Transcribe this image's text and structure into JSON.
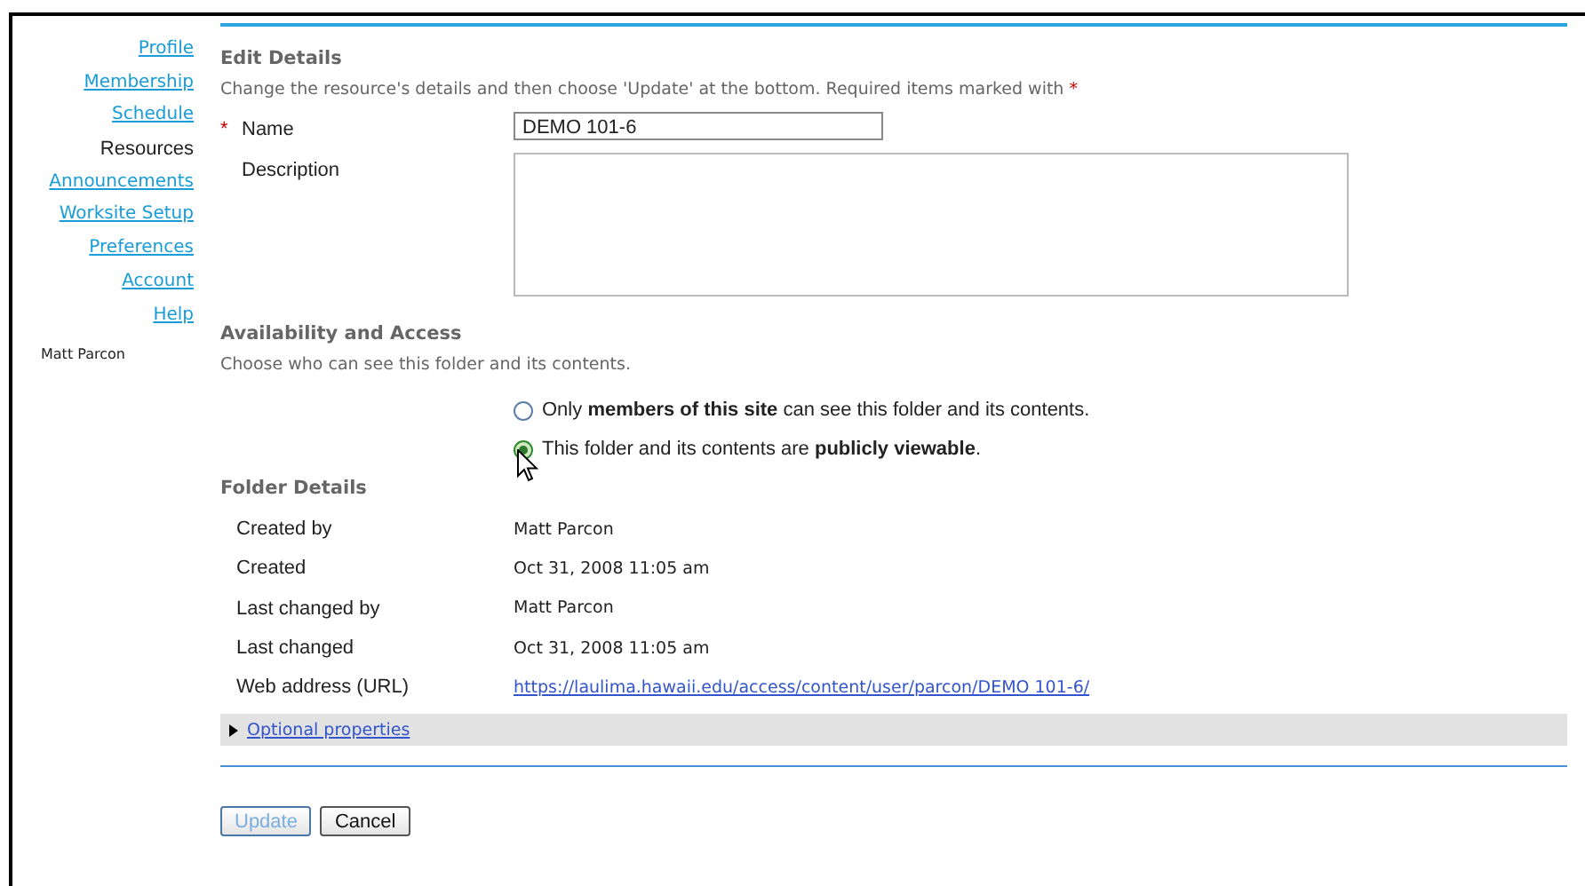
{
  "sidebar": {
    "items": [
      {
        "label": "Profile",
        "selected": false
      },
      {
        "label": "Membership",
        "selected": false
      },
      {
        "label": "Schedule",
        "selected": false
      },
      {
        "label": "Resources",
        "selected": true
      },
      {
        "label": "Announcements",
        "selected": false
      },
      {
        "label": "Worksite Setup",
        "selected": false
      },
      {
        "label": "Preferences",
        "selected": false
      },
      {
        "label": "Account",
        "selected": false
      },
      {
        "label": "Help",
        "selected": false
      }
    ],
    "user": "Matt Parcon"
  },
  "edit_details": {
    "title": "Edit Details",
    "instructions": "Change the resource's details and then choose 'Update' at the bottom. Required items marked with",
    "required_mark": "*",
    "fields": [
      {
        "kind": "input",
        "label": "Name",
        "required": true,
        "value": "DEMO 101-6"
      },
      {
        "kind": "textarea",
        "label": "Description",
        "required": false
      }
    ]
  },
  "availability": {
    "title": "Availability and Access",
    "instructions": "Choose who can see this folder and its contents.",
    "options": [
      {
        "label": "Only **members of this site** can see this folder and its contents.",
        "selected": false
      },
      {
        "label": "This folder and its contents are **publicly viewable**.",
        "selected": true
      }
    ]
  },
  "folder_details": {
    "title": "Folder Details",
    "rows": [
      {
        "label": "Created by",
        "value": "Matt Parcon",
        "kind": "text"
      },
      {
        "label": "Created",
        "value": "Oct 31, 2008 11:05 am",
        "kind": "text"
      },
      {
        "label": "Last changed by",
        "value": "Matt Parcon",
        "kind": "text"
      },
      {
        "label": "Last changed",
        "value": "Oct 31, 2008 11:05 am",
        "kind": "text"
      },
      {
        "label": "Web address (URL)",
        "value": "https://laulima.hawaii.edu/access/content/user/parcon/DEMO 101-6/",
        "kind": "link"
      }
    ]
  },
  "optional_properties": {
    "label": "Optional properties",
    "expanded": false
  },
  "buttons": [
    {
      "label": "Update",
      "kind": "primary"
    },
    {
      "label": "Cancel",
      "kind": "normal"
    }
  ]
}
